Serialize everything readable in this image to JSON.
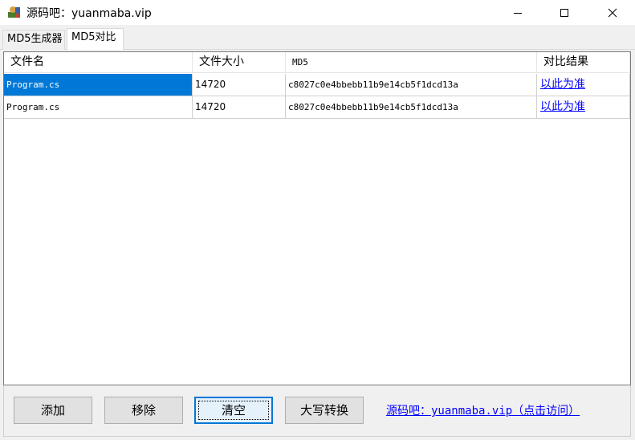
{
  "window": {
    "title": "源码吧：yuanmaba.vip"
  },
  "tabs": [
    {
      "label": "MD5生成器"
    },
    {
      "label": "MD5对比"
    }
  ],
  "table": {
    "columns": [
      "文件名",
      "文件大小",
      "MD5",
      "对比结果"
    ],
    "rows": [
      {
        "name": "Program.cs",
        "size": "14720",
        "md5": "c8027c0e4bbebb11b9e14cb5f1dcd13a",
        "action": "以此为准"
      },
      {
        "name": "Program.cs",
        "size": "14720",
        "md5": "c8027c0e4bbebb11b9e14cb5f1dcd13a",
        "action": "以此为准"
      }
    ]
  },
  "buttons": {
    "add": "添加",
    "remove": "移除",
    "clear": "清空",
    "uppercase": "大写转换"
  },
  "footer_link": "源码吧：yuanmaba.vip（点击访问）",
  "colors": {
    "selection": "#0078d7",
    "link": "#0000ff"
  }
}
